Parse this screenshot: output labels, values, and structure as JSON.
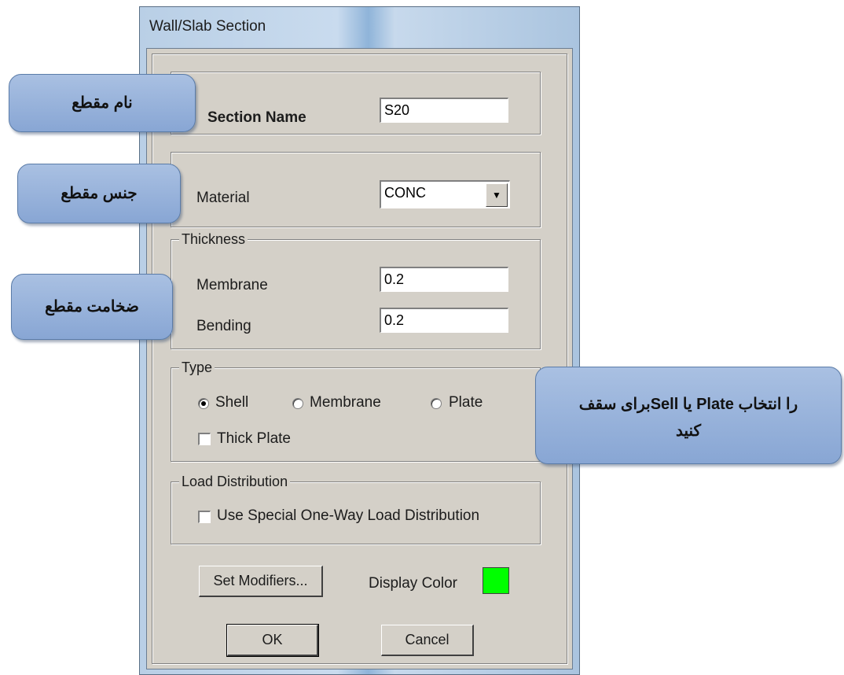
{
  "window": {
    "title": "Wall/Slab Section"
  },
  "section_name": {
    "label": "Section Name",
    "value": "S20"
  },
  "material": {
    "label": "Material",
    "value": "CONC"
  },
  "thickness": {
    "legend": "Thickness",
    "membrane_label": "Membrane",
    "membrane_value": "0.2",
    "bending_label": "Bending",
    "bending_value": "0.2"
  },
  "type": {
    "legend": "Type",
    "options": [
      "Shell",
      "Membrane",
      "Plate"
    ],
    "selected": "Shell",
    "thick_plate_label": "Thick Plate",
    "thick_plate_checked": false
  },
  "load_distribution": {
    "legend": "Load Distribution",
    "checkbox_label": "Use Special One-Way Load Distribution",
    "checked": false
  },
  "buttons": {
    "set_modifiers": "Set Modifiers...",
    "ok": "OK",
    "cancel": "Cancel"
  },
  "display_color": {
    "label": "Display Color",
    "color": "#00ff00"
  },
  "annotations": {
    "section_name": "نام مقطع",
    "material": "جنس مقطع",
    "thickness": "ضخامت مقطع",
    "type_line1": "را انتخاب Plate یا Sellبرای سقف",
    "type_line2": "کنید"
  }
}
